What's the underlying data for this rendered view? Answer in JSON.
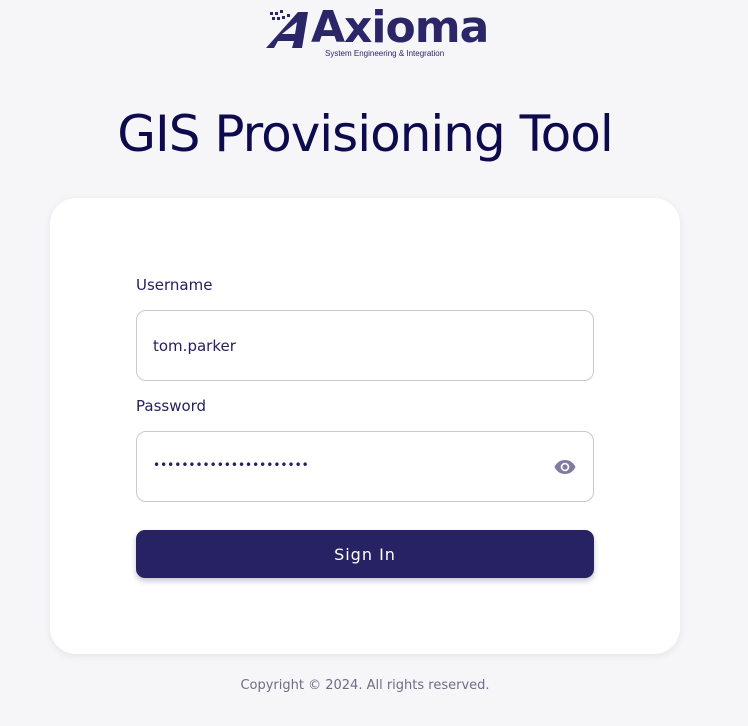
{
  "brand": {
    "name": "Axioma",
    "tagline": "System Engineering & Integration",
    "color": "#2a2668"
  },
  "page": {
    "title": "GIS Provisioning Tool"
  },
  "form": {
    "username_label": "Username",
    "username_value": "tom.parker",
    "password_label": "Password",
    "password_mask": "••••••••••••••••••••••",
    "password_visibility_icon": "eye-icon",
    "submit_label": "Sign In"
  },
  "footer": {
    "copyright": "Copyright © 2024. All rights reserved."
  },
  "colors": {
    "background": "#f6f6f9",
    "primary": "#272263",
    "title": "#0d0a4d",
    "card": "#ffffff",
    "border": "#c9c8d6",
    "muted": "#6f6d86"
  }
}
